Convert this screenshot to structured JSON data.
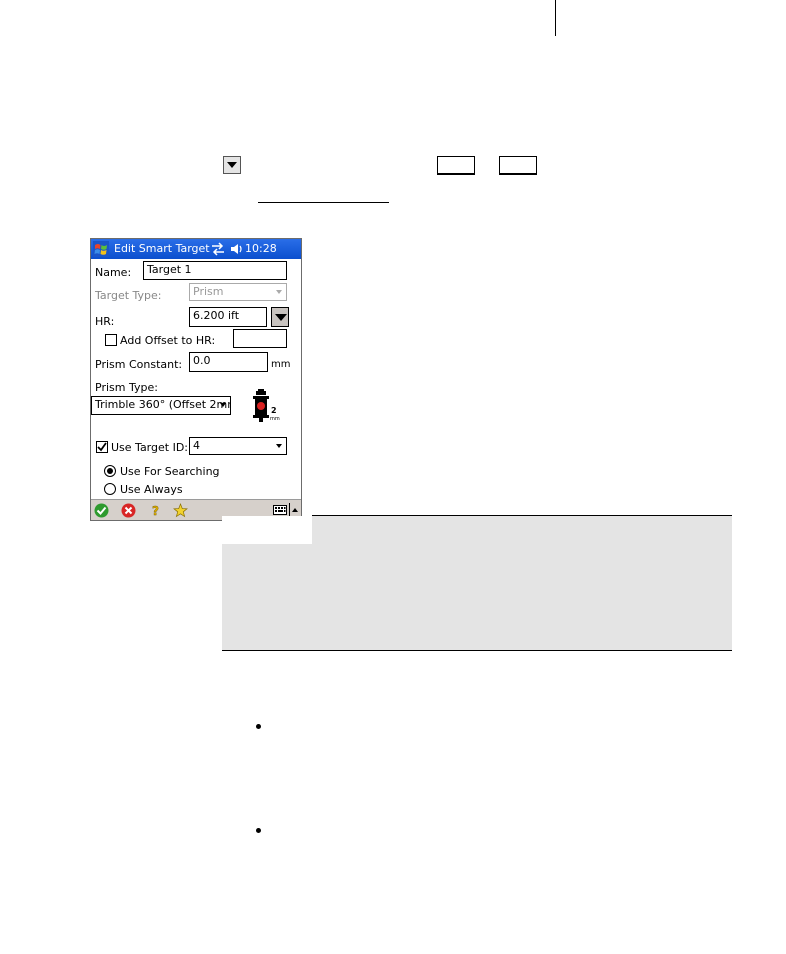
{
  "window": {
    "title": "Edit Smart Target",
    "time": "10:28"
  },
  "form": {
    "name_label": "Name:",
    "name_value": "Target 1",
    "target_type_label": "Target Type:",
    "target_type_value": "Prism",
    "hr_label": "HR:",
    "hr_value": "6.200 ift",
    "add_offset_label": "Add Offset to HR:",
    "add_offset_value": "",
    "prism_constant_label": "Prism Constant:",
    "prism_constant_value": "0.0",
    "prism_constant_unit": "mm",
    "prism_type_label": "Prism Type:",
    "prism_type_value": "Trimble 360° (Offset 2mr",
    "prism_badge_number": "2",
    "prism_badge_unit": "mm",
    "use_target_id_label": "Use Target ID:",
    "use_target_id_checked": true,
    "target_id_value": "4",
    "use_for_searching_label": "Use For Searching",
    "use_always_label": "Use Always"
  },
  "colors": {
    "titlebar": "#0b4fce",
    "menubar": "#d6d0cb",
    "note_box": "#e4e4e4"
  },
  "icons": [
    "windows-flag-icon",
    "sync-arrows-icon",
    "speaker-icon",
    "ok-check-icon",
    "cancel-x-icon",
    "help-icon",
    "favorites-star-icon",
    "keyboard-icon",
    "menu-up-arrow-icon",
    "dropdown-arrow-icon",
    "prism-icon"
  ]
}
